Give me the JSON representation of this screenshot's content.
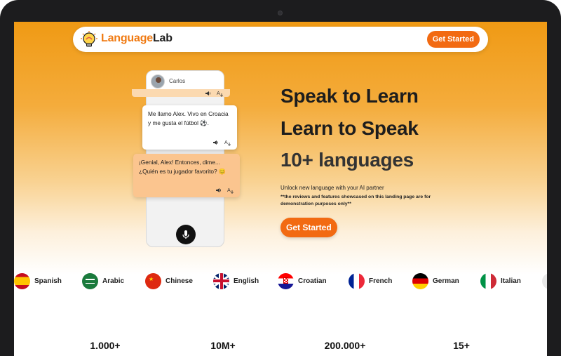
{
  "brand": {
    "name_part1": "Language",
    "name_part2": "Lab",
    "accent": "#f26a12"
  },
  "nav": {
    "cta_label": "Get Started"
  },
  "phone": {
    "contact_name": "Carlos",
    "messages": [
      {
        "text": "Me llamo Alex. Vivo en Croacia y me gusta el fútbol ⚽.",
        "style": "white"
      },
      {
        "text": "¡Genial, Alex! Entonces, dime... ¿Quién es tu jugador favorito? 😊",
        "style": "orange"
      }
    ]
  },
  "hero": {
    "line1": "Speak to Learn",
    "line2": "Learn to Speak",
    "line3": "10+ languages",
    "subtitle": "Unlock new language with your AI partner",
    "disclaimer": "**the reviews and features showcased on this landing page are for demonstration purposes only**",
    "cta_label": "Get Started"
  },
  "languages": [
    {
      "name": "Spanish",
      "icon": "spain-flag-icon"
    },
    {
      "name": "Arabic",
      "icon": "saudi-arabia-flag-icon"
    },
    {
      "name": "Chinese",
      "icon": "china-flag-icon"
    },
    {
      "name": "English",
      "icon": "uk-flag-icon"
    },
    {
      "name": "Croatian",
      "icon": "croatia-flag-icon"
    },
    {
      "name": "French",
      "icon": "france-flag-icon"
    },
    {
      "name": "German",
      "icon": "germany-flag-icon"
    },
    {
      "name": "Italian",
      "icon": "italy-flag-icon"
    }
  ],
  "stats": [
    "1.000+",
    "10M+",
    "200.000+",
    "15+"
  ]
}
